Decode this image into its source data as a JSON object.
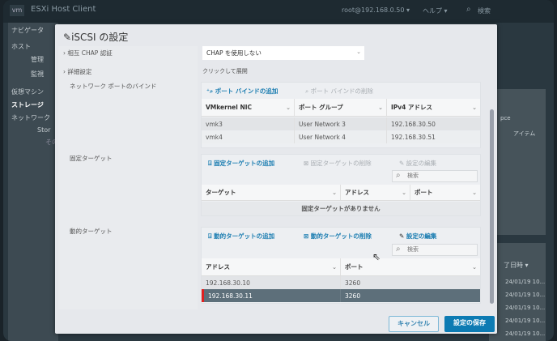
{
  "app": {
    "logo": "vm",
    "title": "ESXi Host Client",
    "user": "root@192.168.0.50 ▾",
    "help": "ヘルプ ▾",
    "search": "検索"
  },
  "nav": {
    "items": [
      "ナビゲータ",
      "ホスト",
      "管理",
      "監視",
      "仮想マシン",
      "ストレージ",
      "ネットワーク",
      "Stor",
      "その"
    ]
  },
  "background": {
    "col_header": "了日時 ▾",
    "items_label": "アイテム",
    "partial": "pce",
    "dates": [
      "24/01/19 10...",
      "24/01/19 10...",
      "24/01/19 10...",
      "24/01/19 10...",
      "24/01/19 10..."
    ]
  },
  "dialog": {
    "title": "iSCSI の設定",
    "chap_label": "相互 CHAP 認証",
    "chap_value": "CHAP を使用しない",
    "advanced_label": "詳細設定",
    "advanced_value": "クリックして展開",
    "binding_label": "ネットワーク ポートのバインド",
    "binding": {
      "add": "ポート バインドの追加",
      "remove": "ポート バインドの削除",
      "columns": [
        "VMkernel NIC",
        "ポート グループ",
        "IPv4 アドレス"
      ],
      "rows": [
        [
          "vmk3",
          "User Network 3",
          "192.168.30.50"
        ],
        [
          "vmk4",
          "User Network 4",
          "192.168.30.51"
        ]
      ]
    },
    "static_label": "固定ターゲット",
    "static": {
      "add": "固定ターゲットの追加",
      "remove": "固定ターゲットの削除",
      "edit": "設定の編集",
      "search_placeholder": "検索",
      "columns": [
        "ターゲット",
        "アドレス",
        "ポート"
      ],
      "empty": "固定ターゲットがありません"
    },
    "dynamic_label": "動的ターゲット",
    "dynamic": {
      "add": "動的ターゲットの追加",
      "remove": "動的ターゲットの削除",
      "edit": "設定の編集",
      "search_placeholder": "検索",
      "columns": [
        "アドレス",
        "ポート"
      ],
      "rows": [
        [
          "192.168.30.10",
          "3260"
        ],
        [
          "192.168.30.11",
          "3260"
        ]
      ],
      "selected_row": 1
    },
    "cancel": "キャンセル",
    "save": "設定の保存"
  }
}
